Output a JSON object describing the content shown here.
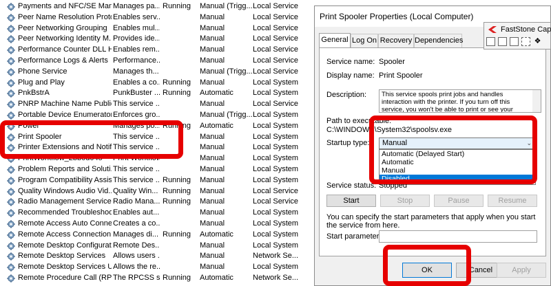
{
  "services": [
    {
      "name": "Payments and NFC/SE Manag...",
      "desc": "Manages pa...",
      "status": "Running",
      "startup": "Manual (Trigg...",
      "logon": "Local Service"
    },
    {
      "name": "Peer Name Resolution Proto...",
      "desc": "Enables serv...",
      "status": "",
      "startup": "Manual",
      "logon": "Local Service"
    },
    {
      "name": "Peer Networking Grouping",
      "desc": "Enables mul...",
      "status": "",
      "startup": "Manual",
      "logon": "Local Service"
    },
    {
      "name": "Peer Networking Identity M...",
      "desc": "Provides ide...",
      "status": "",
      "startup": "Manual",
      "logon": "Local Service"
    },
    {
      "name": "Performance Counter DLL H...",
      "desc": "Enables rem...",
      "status": "",
      "startup": "Manual",
      "logon": "Local Service"
    },
    {
      "name": "Performance Logs & Alerts",
      "desc": "Performance...",
      "status": "",
      "startup": "Manual",
      "logon": "Local Service"
    },
    {
      "name": "Phone Service",
      "desc": "Manages th...",
      "status": "",
      "startup": "Manual (Trigg...",
      "logon": "Local Service"
    },
    {
      "name": "Plug and Play",
      "desc": "Enables a co...",
      "status": "Running",
      "startup": "Manual",
      "logon": "Local System"
    },
    {
      "name": "PnkBstrA",
      "desc": "PunkBuster ...",
      "status": "Running",
      "startup": "Automatic",
      "logon": "Local System"
    },
    {
      "name": "PNRP Machine Name Public...",
      "desc": "This service ...",
      "status": "",
      "startup": "Manual",
      "logon": "Local Service"
    },
    {
      "name": "Portable Device Enumerator ...",
      "desc": "Enforces gro...",
      "status": "",
      "startup": "Manual (Trigg...",
      "logon": "Local System"
    },
    {
      "name": "Power",
      "desc": "Manages po...",
      "status": "Running",
      "startup": "Automatic",
      "logon": "Local System"
    },
    {
      "name": "Print Spooler",
      "desc": "This service ...",
      "status": "",
      "startup": "Manual",
      "logon": "Local System"
    },
    {
      "name": "Printer Extensions and Notifi...",
      "desc": "This service ...",
      "status": "",
      "startup": "Manual",
      "logon": "Local System"
    },
    {
      "name": "PrintWorkflow_2bb0d045",
      "desc": "Print Workflow",
      "status": "",
      "startup": "Manual",
      "logon": "Local System"
    },
    {
      "name": "Problem Reports and Soluti...",
      "desc": "This service ...",
      "status": "",
      "startup": "Manual",
      "logon": "Local System"
    },
    {
      "name": "Program Compatibility Assis...",
      "desc": "This service ...",
      "status": "Running",
      "startup": "Manual",
      "logon": "Local System"
    },
    {
      "name": "Quality Windows Audio Vid...",
      "desc": "Quality Win...",
      "status": "Running",
      "startup": "Manual",
      "logon": "Local Service"
    },
    {
      "name": "Radio Management Service",
      "desc": "Radio Mana...",
      "status": "Running",
      "startup": "Manual",
      "logon": "Local Service"
    },
    {
      "name": "Recommended Troubleshoo...",
      "desc": "Enables aut...",
      "status": "",
      "startup": "Manual",
      "logon": "Local System"
    },
    {
      "name": "Remote Access Auto Connec...",
      "desc": "Creates a co...",
      "status": "",
      "startup": "Manual",
      "logon": "Local System"
    },
    {
      "name": "Remote Access Connection ...",
      "desc": "Manages di...",
      "status": "Running",
      "startup": "Automatic",
      "logon": "Local System"
    },
    {
      "name": "Remote Desktop Configurati...",
      "desc": "Remote Des...",
      "status": "",
      "startup": "Manual",
      "logon": "Local System"
    },
    {
      "name": "Remote Desktop Services",
      "desc": "Allows users ...",
      "status": "",
      "startup": "Manual",
      "logon": "Network Se..."
    },
    {
      "name": "Remote Desktop Services Us...",
      "desc": "Allows the re...",
      "status": "",
      "startup": "Manual",
      "logon": "Local System"
    },
    {
      "name": "Remote Procedure Call (RPC)",
      "desc": "The RPCSS s...",
      "status": "Running",
      "startup": "Automatic",
      "logon": "Network Se..."
    }
  ],
  "dialog": {
    "title": "Print Spooler Properties (Local Computer)",
    "tabs": [
      "General",
      "Log On",
      "Recovery",
      "Dependencies"
    ],
    "service_name_label": "Service name:",
    "service_name": "Spooler",
    "display_name_label": "Display name:",
    "display_name": "Print Spooler",
    "description_label": "Description:",
    "description": "This service spools print jobs and handles interaction with the printer.  If you turn off this service, you won't be able to print or see your printers.",
    "path_label": "Path to executable:",
    "path": "C:\\WINDOWS\\System32\\spoolsv.exe",
    "startup_type_label": "Startup type:",
    "startup_type_value": "Manual",
    "startup_options": [
      "Automatic (Delayed Start)",
      "Automatic",
      "Manual",
      "Disabled"
    ],
    "highlighted_option": "Disabled",
    "service_status_label": "Service status:",
    "service_status": "Stopped",
    "buttons": {
      "start": "Start",
      "stop": "Stop",
      "pause": "Pause",
      "resume": "Resume"
    },
    "hint": "You can specify the start parameters that apply when you start the service from here.",
    "start_params_label": "Start parameters:",
    "ok": "OK",
    "cancel": "Cancel",
    "apply": "Apply"
  },
  "faststone": {
    "title": "FastStone Captu"
  },
  "colors": {
    "highlight_red": "#e60000",
    "selection_blue": "#0078d7"
  }
}
